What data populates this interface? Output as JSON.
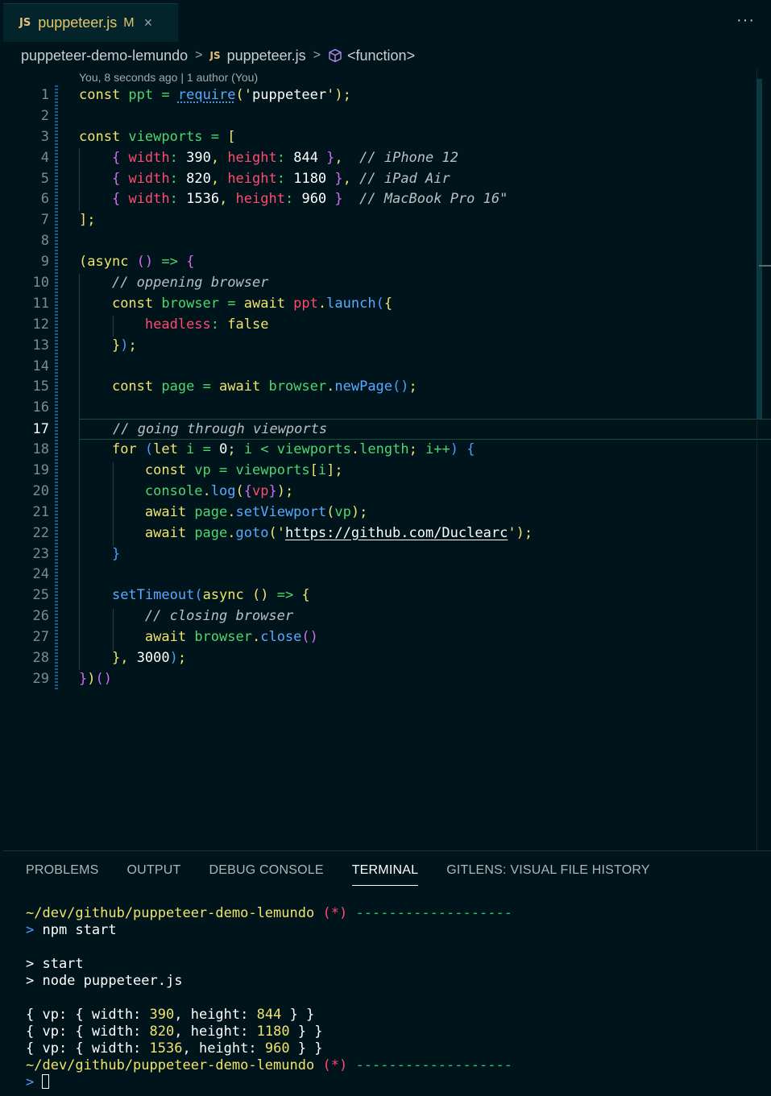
{
  "tab": {
    "badge": "JS",
    "name": "puppeteer.js",
    "modified": "M",
    "close": "×"
  },
  "more_label": "···",
  "breadcrumb": {
    "folder": "puppeteer-demo-lemundo",
    "file": "puppeteer.js",
    "symbol": "<function>",
    "sep": ">",
    "badge": "JS"
  },
  "blame": "You, 8 seconds ago | 1 author (You)",
  "current_line": 17,
  "code_lines": [
    [
      [
        "k",
        "const "
      ],
      [
        "v",
        "ppt"
      ],
      [
        "op",
        " = "
      ],
      [
        "f udot",
        "require"
      ],
      [
        "br1",
        "("
      ],
      [
        "q",
        "'"
      ],
      [
        "s",
        "puppeteer"
      ],
      [
        "q",
        "'"
      ],
      [
        "br1",
        ")"
      ],
      [
        "k",
        ";"
      ]
    ],
    [],
    [
      [
        "k",
        "const "
      ],
      [
        "v",
        "viewports"
      ],
      [
        "op",
        " = "
      ],
      [
        "br1",
        "["
      ]
    ],
    [
      [
        "p",
        "    "
      ],
      [
        "br2",
        "{ "
      ],
      [
        "pr",
        "width"
      ],
      [
        "op",
        ": "
      ],
      [
        "n",
        "390"
      ],
      [
        "k",
        ", "
      ],
      [
        "pr",
        "height"
      ],
      [
        "op",
        ": "
      ],
      [
        "n",
        "844"
      ],
      [
        "br2",
        " }"
      ],
      [
        "k",
        ","
      ],
      [
        "c",
        "  // iPhone 12"
      ]
    ],
    [
      [
        "p",
        "    "
      ],
      [
        "br2",
        "{ "
      ],
      [
        "pr",
        "width"
      ],
      [
        "op",
        ": "
      ],
      [
        "n",
        "820"
      ],
      [
        "k",
        ", "
      ],
      [
        "pr",
        "height"
      ],
      [
        "op",
        ": "
      ],
      [
        "n",
        "1180"
      ],
      [
        "br2",
        " }"
      ],
      [
        "k",
        ","
      ],
      [
        "c",
        " // iPad Air"
      ]
    ],
    [
      [
        "p",
        "    "
      ],
      [
        "br2",
        "{ "
      ],
      [
        "pr",
        "width"
      ],
      [
        "op",
        ": "
      ],
      [
        "n",
        "1536"
      ],
      [
        "k",
        ", "
      ],
      [
        "pr",
        "height"
      ],
      [
        "op",
        ": "
      ],
      [
        "n",
        "960"
      ],
      [
        "br2",
        " }"
      ],
      [
        "c",
        "  // MacBook Pro 16\""
      ]
    ],
    [
      [
        "br1",
        "]"
      ],
      [
        "k",
        ";"
      ]
    ],
    [],
    [
      [
        "br1",
        "("
      ],
      [
        "k",
        "async "
      ],
      [
        "br2",
        "()"
      ],
      [
        "op",
        " => "
      ],
      [
        "br2",
        "{"
      ]
    ],
    [
      [
        "p",
        "    "
      ],
      [
        "c",
        "// oppening browser"
      ]
    ],
    [
      [
        "p",
        "    "
      ],
      [
        "k",
        "const "
      ],
      [
        "v",
        "browser"
      ],
      [
        "op",
        " = "
      ],
      [
        "k",
        "await "
      ],
      [
        "pr",
        "ppt"
      ],
      [
        "k",
        "."
      ],
      [
        "f",
        "launch"
      ],
      [
        "br3",
        "("
      ],
      [
        "br1",
        "{"
      ]
    ],
    [
      [
        "p",
        "        "
      ],
      [
        "pr",
        "headless"
      ],
      [
        "op",
        ": "
      ],
      [
        "k",
        "false"
      ]
    ],
    [
      [
        "p",
        "    "
      ],
      [
        "br1",
        "}"
      ],
      [
        "br3",
        ")"
      ],
      [
        "k",
        ";"
      ]
    ],
    [],
    [
      [
        "p",
        "    "
      ],
      [
        "k",
        "const "
      ],
      [
        "v",
        "page"
      ],
      [
        "op",
        " = "
      ],
      [
        "k",
        "await "
      ],
      [
        "v",
        "browser"
      ],
      [
        "k",
        "."
      ],
      [
        "f",
        "newPage"
      ],
      [
        "br3",
        "()"
      ],
      [
        "k",
        ";"
      ]
    ],
    [],
    [
      [
        "c",
        "// going through viewports"
      ]
    ],
    [
      [
        "p",
        "    "
      ],
      [
        "k",
        "for "
      ],
      [
        "br3",
        "("
      ],
      [
        "k",
        "let "
      ],
      [
        "v",
        "i"
      ],
      [
        "op",
        " = "
      ],
      [
        "n",
        "0"
      ],
      [
        "k",
        "; "
      ],
      [
        "v",
        "i"
      ],
      [
        "op",
        " < "
      ],
      [
        "v",
        "viewports"
      ],
      [
        "k",
        "."
      ],
      [
        "v",
        "length"
      ],
      [
        "k",
        "; "
      ],
      [
        "v",
        "i++"
      ],
      [
        "br3",
        ")"
      ],
      [
        "br3",
        " {"
      ]
    ],
    [
      [
        "p",
        "        "
      ],
      [
        "k",
        "const "
      ],
      [
        "v",
        "vp"
      ],
      [
        "op",
        " = "
      ],
      [
        "v",
        "viewports"
      ],
      [
        "br1",
        "["
      ],
      [
        "v",
        "i"
      ],
      [
        "br1",
        "]"
      ],
      [
        "k",
        ";"
      ]
    ],
    [
      [
        "p",
        "        "
      ],
      [
        "v",
        "console"
      ],
      [
        "k",
        "."
      ],
      [
        "f",
        "log"
      ],
      [
        "br1",
        "("
      ],
      [
        "br2",
        "{"
      ],
      [
        "pr",
        "vp"
      ],
      [
        "br2",
        "}"
      ],
      [
        "br1",
        ")"
      ],
      [
        "k",
        ";"
      ]
    ],
    [
      [
        "p",
        "        "
      ],
      [
        "k",
        "await "
      ],
      [
        "v",
        "page"
      ],
      [
        "k",
        "."
      ],
      [
        "f",
        "setViewport"
      ],
      [
        "br1",
        "("
      ],
      [
        "v",
        "vp"
      ],
      [
        "br1",
        ")"
      ],
      [
        "k",
        ";"
      ]
    ],
    [
      [
        "p",
        "        "
      ],
      [
        "k",
        "await "
      ],
      [
        "v",
        "page"
      ],
      [
        "k",
        "."
      ],
      [
        "f",
        "goto"
      ],
      [
        "br1",
        "("
      ],
      [
        "q",
        "'"
      ],
      [
        "s u",
        "https://github.com/Duclearc"
      ],
      [
        "q",
        "'"
      ],
      [
        "br1",
        ")"
      ],
      [
        "k",
        ";"
      ]
    ],
    [
      [
        "p",
        "    "
      ],
      [
        "br3",
        "}"
      ]
    ],
    [],
    [
      [
        "p",
        "    "
      ],
      [
        "f",
        "setTimeout"
      ],
      [
        "br3",
        "("
      ],
      [
        "k",
        "async "
      ],
      [
        "br1",
        "()"
      ],
      [
        "op",
        " => "
      ],
      [
        "br1",
        "{"
      ]
    ],
    [
      [
        "p",
        "        "
      ],
      [
        "c",
        "// closing browser"
      ]
    ],
    [
      [
        "p",
        "        "
      ],
      [
        "k",
        "await "
      ],
      [
        "v",
        "browser"
      ],
      [
        "k",
        "."
      ],
      [
        "f",
        "close"
      ],
      [
        "br2",
        "()"
      ]
    ],
    [
      [
        "p",
        "    "
      ],
      [
        "br1",
        "}"
      ],
      [
        "k",
        ", "
      ],
      [
        "n",
        "3000"
      ],
      [
        "br3",
        ")"
      ],
      [
        "k",
        ";"
      ]
    ],
    [
      [
        "br2",
        "}"
      ],
      [
        "br1",
        ")"
      ],
      [
        "br2",
        "()"
      ]
    ]
  ],
  "panel_tabs": [
    {
      "label": "PROBLEMS",
      "active": false
    },
    {
      "label": "OUTPUT",
      "active": false
    },
    {
      "label": "DEBUG CONSOLE",
      "active": false
    },
    {
      "label": "TERMINAL",
      "active": true
    },
    {
      "label": "GITLENS: VISUAL FILE HISTORY",
      "active": false
    }
  ],
  "terminal_lines": [
    [
      [
        "tpath",
        "~/dev/github/puppeteer-demo-lemundo"
      ],
      [
        "t",
        " "
      ],
      [
        "tstar",
        "(*)"
      ],
      [
        "t",
        " "
      ],
      [
        "tdash",
        "-------------------"
      ]
    ],
    [
      [
        "tprompt",
        "> "
      ],
      [
        "t",
        "npm start"
      ]
    ],
    [],
    [
      [
        "t",
        "> start"
      ]
    ],
    [
      [
        "t",
        "> node puppeteer.js"
      ]
    ],
    [],
    [
      [
        "t",
        "{ vp: { width: "
      ],
      [
        "tnum",
        "390"
      ],
      [
        "t",
        ", height: "
      ],
      [
        "tnum",
        "844"
      ],
      [
        "t",
        " } }"
      ]
    ],
    [
      [
        "t",
        "{ vp: { width: "
      ],
      [
        "tnum",
        "820"
      ],
      [
        "t",
        ", height: "
      ],
      [
        "tnum",
        "1180"
      ],
      [
        "t",
        " } }"
      ]
    ],
    [
      [
        "t",
        "{ vp: { width: "
      ],
      [
        "tnum",
        "1536"
      ],
      [
        "t",
        ", height: "
      ],
      [
        "tnum",
        "960"
      ],
      [
        "t",
        " } }"
      ]
    ],
    [
      [
        "tpath",
        "~/dev/github/puppeteer-demo-lemundo"
      ],
      [
        "t",
        " "
      ],
      [
        "tstar",
        "(*)"
      ],
      [
        "t",
        " "
      ],
      [
        "tdash",
        "-------------------"
      ]
    ],
    [
      [
        "tprompt",
        "> "
      ],
      [
        "cursor",
        ""
      ]
    ]
  ]
}
